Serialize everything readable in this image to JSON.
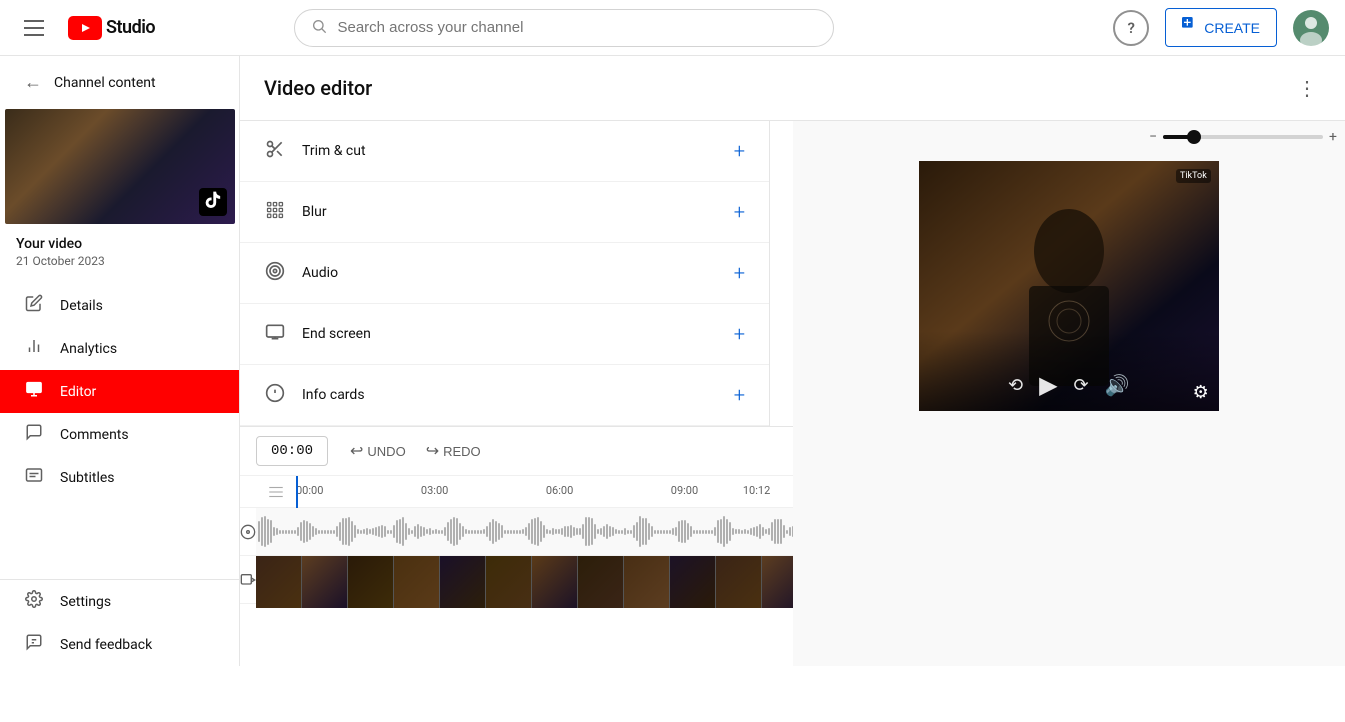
{
  "header": {
    "menu_label": "Menu",
    "logo_text": "Studio",
    "search_placeholder": "Search across your channel",
    "help_label": "?",
    "create_label": "CREATE",
    "avatar_alt": "User avatar"
  },
  "sidebar": {
    "channel_content_label": "Channel content",
    "video_title": "Your video",
    "video_date": "21 October 2023",
    "nav_items": [
      {
        "id": "details",
        "label": "Details",
        "icon": "✏"
      },
      {
        "id": "analytics",
        "label": "Analytics",
        "icon": "📊"
      },
      {
        "id": "editor",
        "label": "Editor",
        "icon": "🎬",
        "active": true
      },
      {
        "id": "comments",
        "label": "Comments",
        "icon": "💬"
      },
      {
        "id": "subtitles",
        "label": "Subtitles",
        "icon": "📄"
      }
    ],
    "bottom_nav": [
      {
        "id": "settings",
        "label": "Settings",
        "icon": "⚙"
      },
      {
        "id": "feedback",
        "label": "Send feedback",
        "icon": "💬"
      }
    ]
  },
  "editor": {
    "title": "Video editor",
    "tools": [
      {
        "id": "trim-cut",
        "label": "Trim & cut",
        "icon": "✂"
      },
      {
        "id": "blur",
        "label": "Blur",
        "icon": "⊞"
      },
      {
        "id": "audio",
        "label": "Audio",
        "icon": "♪"
      },
      {
        "id": "end-screen",
        "label": "End screen",
        "icon": "🖥"
      },
      {
        "id": "info-cards",
        "label": "Info cards",
        "icon": "ℹ"
      }
    ],
    "toolbar": {
      "time": "00:00",
      "undo_label": "UNDO",
      "redo_label": "REDO"
    },
    "timeline": {
      "markers": [
        "00:00",
        "03:00",
        "06:00",
        "09:00",
        "10:12"
      ],
      "marker_positions": [
        0,
        26,
        52,
        78,
        95
      ]
    },
    "zoom": {
      "min_label": "−",
      "max_label": "+"
    }
  }
}
